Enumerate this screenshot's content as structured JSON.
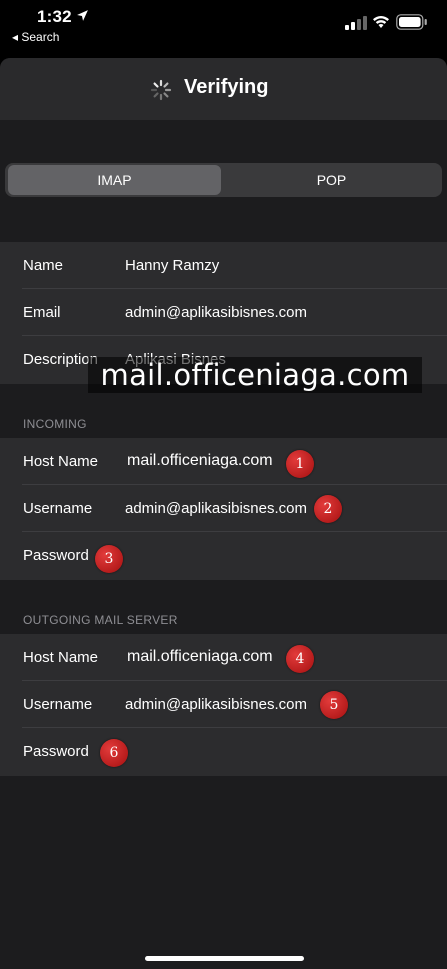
{
  "status_bar": {
    "time": "1:32",
    "back_label": "◂ Search",
    "icons": [
      "location-arrow-icon",
      "signal-icon",
      "wifi-icon",
      "battery-icon"
    ]
  },
  "nav": {
    "title": "Verifying",
    "spinner_icon": "activity-spinner-icon"
  },
  "segmented": {
    "options": [
      "IMAP",
      "POP"
    ],
    "selected": "IMAP"
  },
  "account": {
    "rows": [
      {
        "label": "Name",
        "value": "Hanny Ramzy"
      },
      {
        "label": "Email",
        "value": "admin@aplikasibisnes.com"
      },
      {
        "label": "Description",
        "value": "Aplikasi Bisnes"
      }
    ]
  },
  "incoming": {
    "header": "INCOMING",
    "host_label": "Host Name",
    "host_value": "mail.officeniaga.com",
    "username_label": "Username",
    "username_value": "admin@aplikasibisnes.com",
    "password_label": "Password"
  },
  "outgoing": {
    "header": "OUTGOING MAIL SERVER",
    "host_label": "Host Name",
    "host_value": "mail.officeniaga.com",
    "username_label": "Username",
    "username_value": "admin@aplikasibisnes.com",
    "password_label": "Password"
  },
  "watermark": "mail.officeniaga.com",
  "badges": [
    "1",
    "2",
    "3",
    "4",
    "5",
    "6"
  ],
  "colors": {
    "badge": "#c21a1a",
    "sheet": "#1c1c1e",
    "group": "#2c2c2e",
    "segment_selected": "#636366"
  }
}
